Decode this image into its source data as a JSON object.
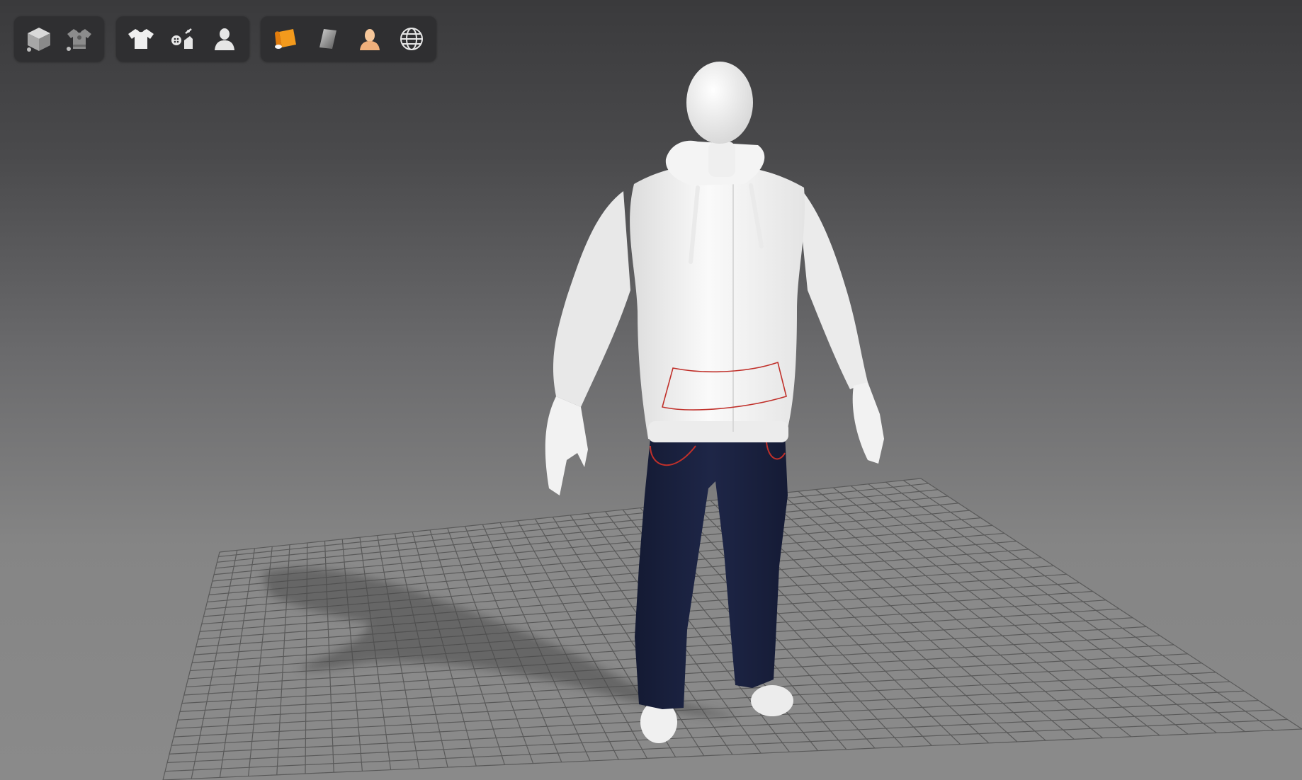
{
  "app": {
    "window_title": ""
  },
  "toolbar": {
    "groups": [
      {
        "name": "display-modes",
        "buttons": [
          {
            "icon": "cube-icon",
            "tooltip": ""
          },
          {
            "icon": "garment-texture-icon",
            "tooltip": ""
          }
        ]
      },
      {
        "name": "visibility",
        "buttons": [
          {
            "icon": "tshirt-icon",
            "tooltip": ""
          },
          {
            "icon": "buttons-trims-icon",
            "tooltip": ""
          },
          {
            "icon": "avatar-icon",
            "tooltip": ""
          }
        ]
      },
      {
        "name": "rendering",
        "buttons": [
          {
            "icon": "fabric-roll-icon",
            "tooltip": ""
          },
          {
            "icon": "material-swatch-icon",
            "tooltip": ""
          },
          {
            "icon": "avatar-skin-icon",
            "tooltip": ""
          },
          {
            "icon": "globe-icon",
            "tooltip": ""
          }
        ]
      }
    ]
  },
  "scene": {
    "garments": [
      "hoodie",
      "jeans"
    ],
    "colors": {
      "hoodie": "#f2f2f2",
      "jeans": "#1b2240",
      "avatar": "#f4f4f4",
      "stitch_accent": "#c0302a",
      "grid_line": "#5a5a5a"
    }
  }
}
